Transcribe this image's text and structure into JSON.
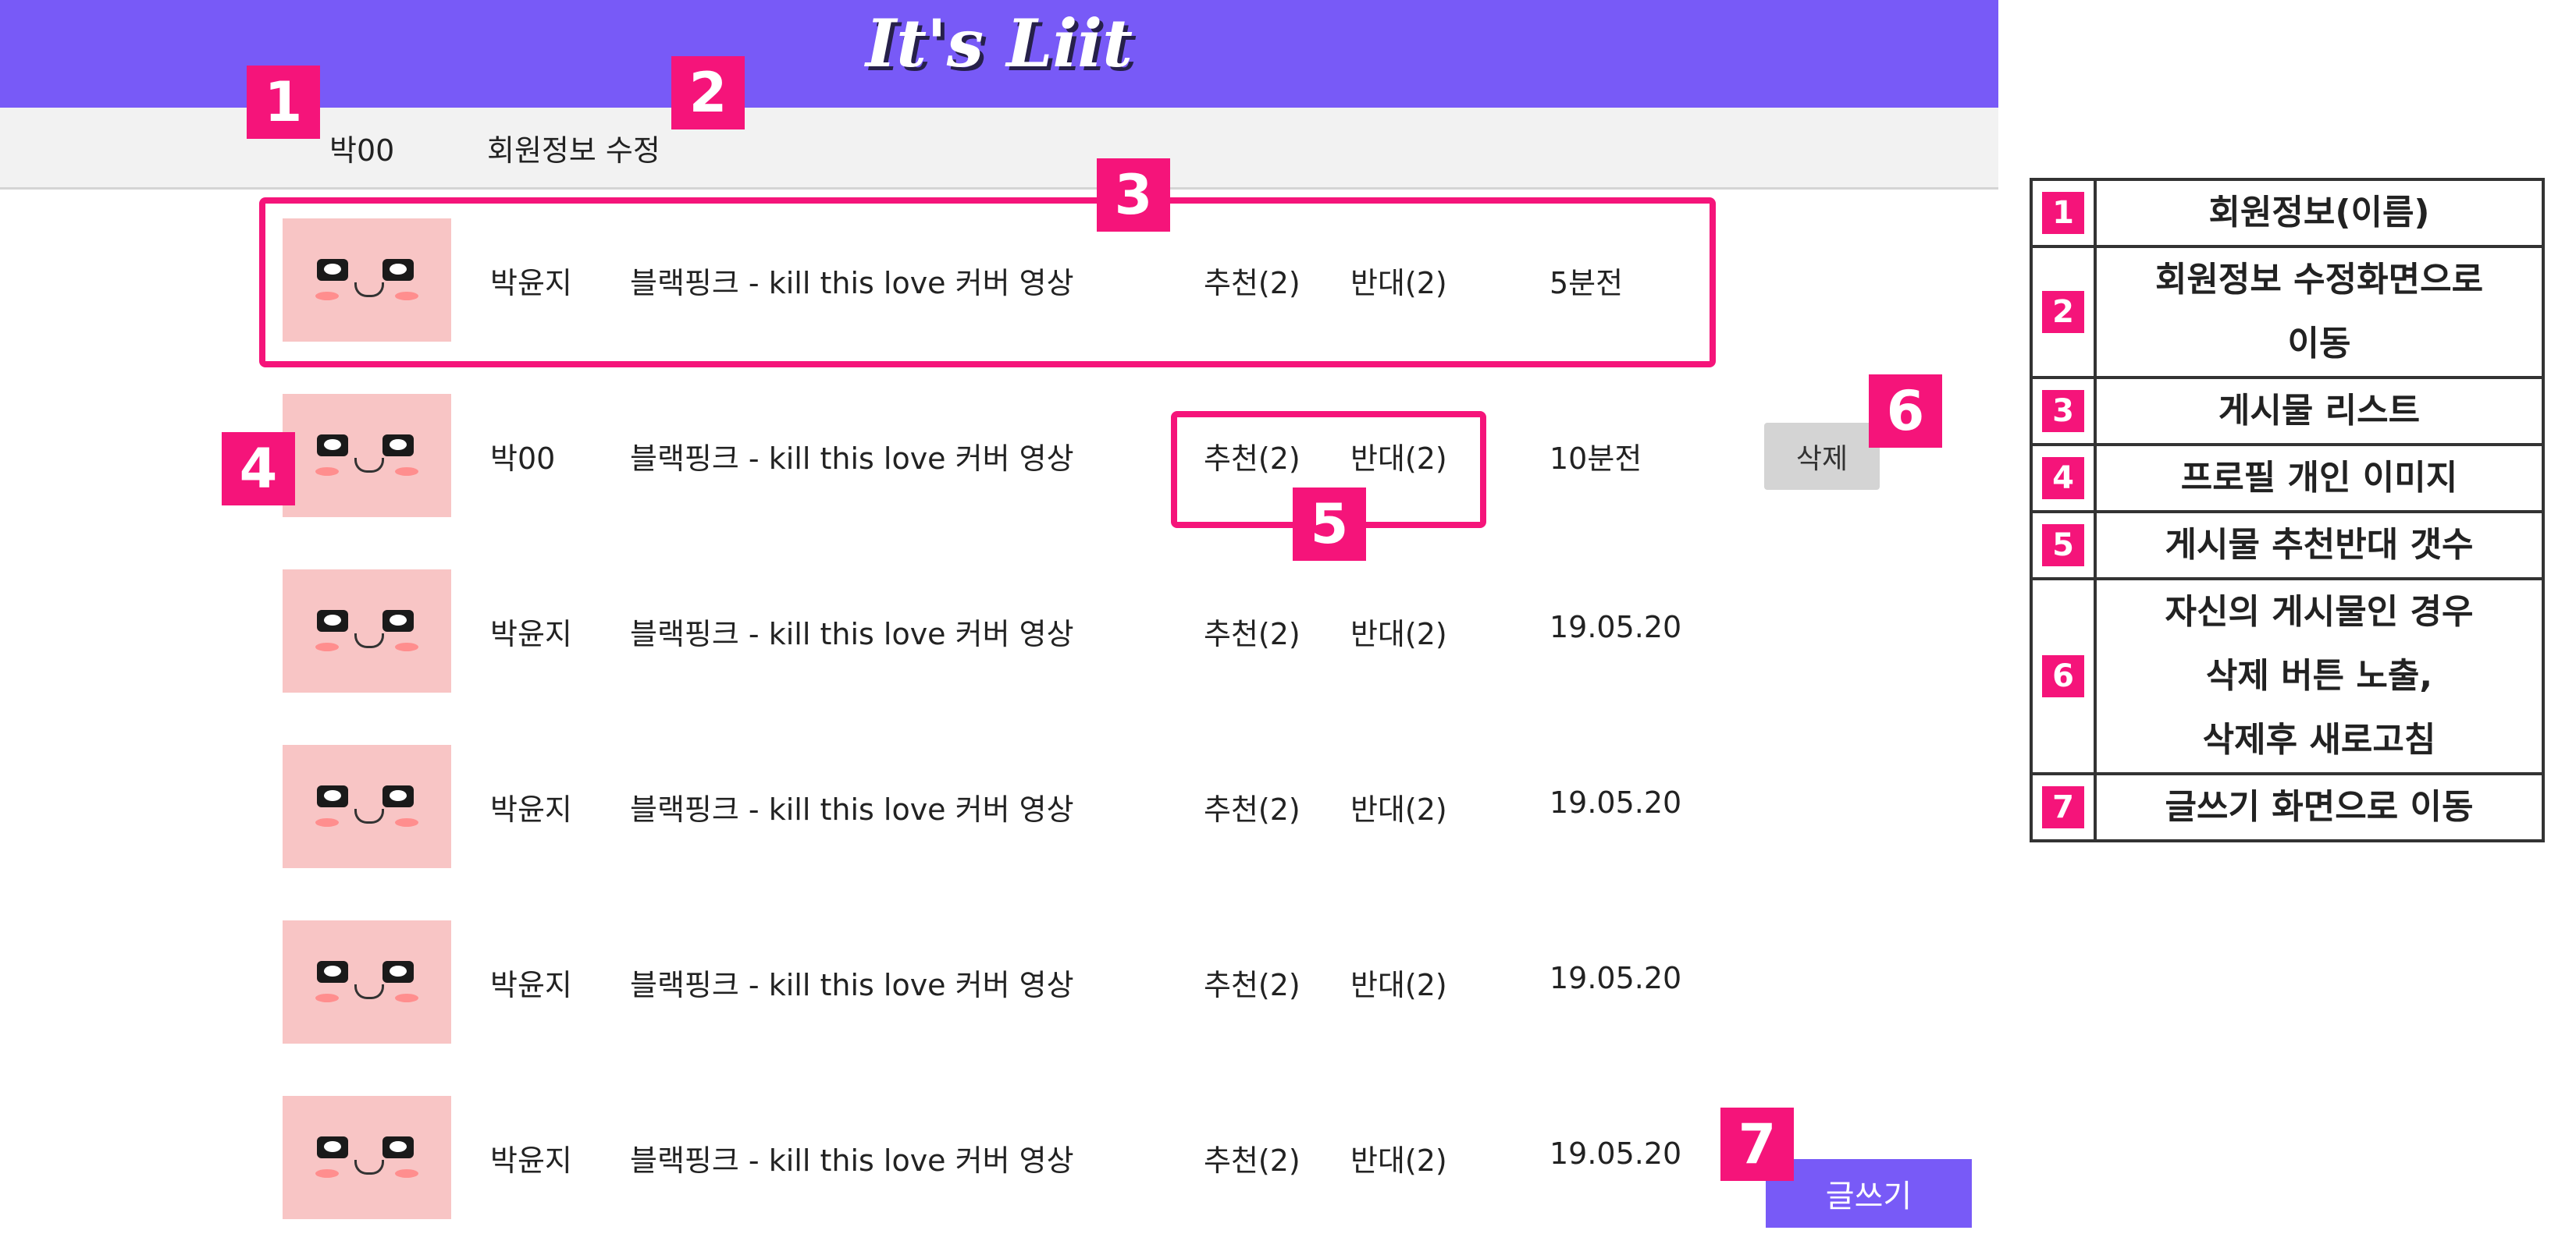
{
  "app": {
    "logo": "It's Liit"
  },
  "member_bar": {
    "name": "박00",
    "edit_link": "회원정보 수정"
  },
  "posts": [
    {
      "author": "박윤지",
      "title": "블랙핑크 - kill this love 커버 영상",
      "recommend": "추천(2)",
      "oppose": "반대(2)",
      "time": "5분전"
    },
    {
      "author": "박00",
      "title": "블랙핑크 - kill this love 커버 영상",
      "recommend": "추천(2)",
      "oppose": "반대(2)",
      "time": "10분전",
      "delete_label": "삭제"
    },
    {
      "author": "박윤지",
      "title": "블랙핑크 - kill this love 커버 영상",
      "recommend": "추천(2)",
      "oppose": "반대(2)",
      "time": "19.05.20"
    },
    {
      "author": "박윤지",
      "title": "블랙핑크 - kill this love 커버 영상",
      "recommend": "추천(2)",
      "oppose": "반대(2)",
      "time": "19.05.20"
    },
    {
      "author": "박윤지",
      "title": "블랙핑크 - kill this love 커버 영상",
      "recommend": "추천(2)",
      "oppose": "반대(2)",
      "time": "19.05.20"
    },
    {
      "author": "박윤지",
      "title": "블랙핑크 - kill this love 커버 영상",
      "recommend": "추천(2)",
      "oppose": "반대(2)",
      "time": "19.05.20"
    }
  ],
  "write_button": "글쓰기",
  "badges": [
    "1",
    "2",
    "3",
    "4",
    "5",
    "6",
    "7"
  ],
  "legend": [
    {
      "num": "1",
      "text": "회원정보(이름)"
    },
    {
      "num": "2",
      "text": "회원정보 수정화면으로\n이동"
    },
    {
      "num": "3",
      "text": "게시물 리스트"
    },
    {
      "num": "4",
      "text": "프로필 개인 이미지"
    },
    {
      "num": "5",
      "text": "게시물 추천반대 갯수"
    },
    {
      "num": "6",
      "text": "자신의 게시물인 경우\n삭제 버튼 노출,\n삭제후 새로고침"
    },
    {
      "num": "7",
      "text": "글쓰기 화면으로 이동"
    }
  ],
  "colors": {
    "header": "#785af7",
    "annotation": "#f5147a",
    "avatar_bg": "#f8c5c5",
    "subbar": "#f2f2f2"
  }
}
